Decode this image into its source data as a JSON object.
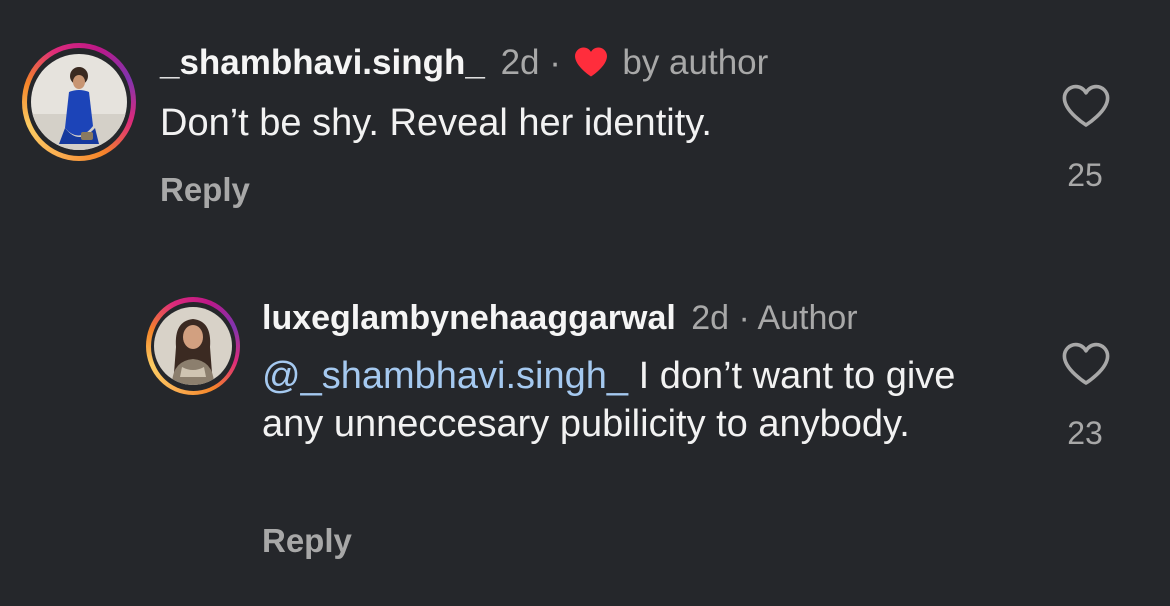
{
  "comments": [
    {
      "username": "_shambhavi.singh_",
      "time": "2d",
      "separator": "·",
      "liked_label": "by author",
      "text": "Don’t be shy. Reveal her identity.",
      "reply_label": "Reply",
      "like_count": "25",
      "avatar_icon": "profile-photo-woman-blue-dress"
    },
    {
      "username": "luxeglambynehaaggarwal",
      "time": "2d",
      "separator": "·",
      "author_label": "Author",
      "mention": "@_shambhavi.singh_",
      "text": " I don’t want to give any unneccesary pubilicity to anybody.",
      "reply_label": "Reply",
      "like_count": "23",
      "avatar_icon": "profile-photo-woman-long-hair"
    }
  ],
  "colors": {
    "background": "#25272b",
    "text": "#f2f2f2",
    "muted": "#a8a8a8",
    "mention": "#a5c9f0",
    "author_heart": "#ff2d3c"
  }
}
